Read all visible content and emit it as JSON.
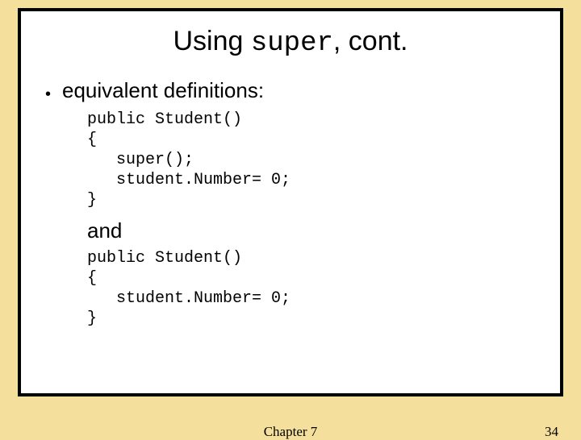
{
  "title": {
    "pre": "Using ",
    "code": "super",
    "post": ", cont."
  },
  "bullet": "equivalent definitions:",
  "code1": "public Student()\n{\n   super();\n   student.Number= 0;\n}",
  "and": "and",
  "code2": "public Student()\n{\n   student.Number= 0;\n}",
  "footer": {
    "chapter": "Chapter 7",
    "page": "34"
  }
}
